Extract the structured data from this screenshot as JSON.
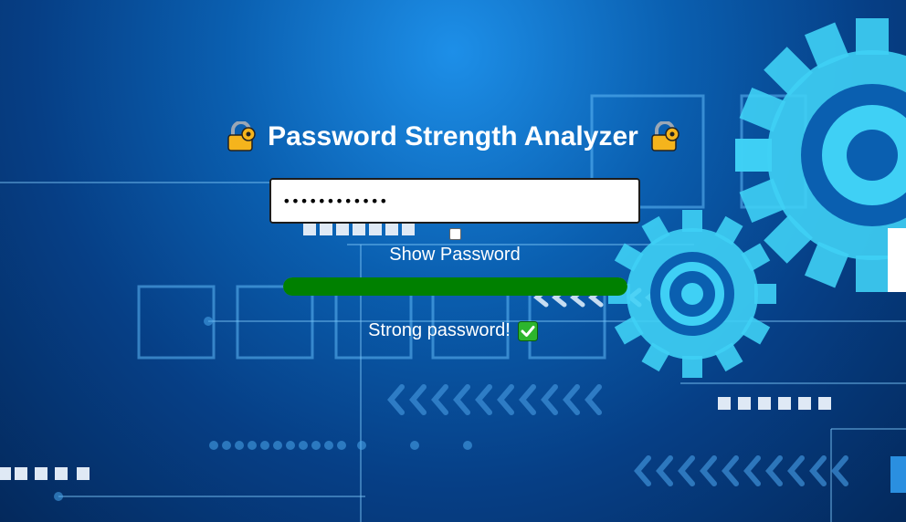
{
  "app": {
    "title": "Password Strength Analyzer"
  },
  "form": {
    "password_value": "••••••••••••",
    "show_password_label": "Show Password",
    "show_password_checked": false
  },
  "strength": {
    "fraction": 1.0,
    "color": "#008000",
    "message": "Strong password!"
  },
  "icons": {
    "title_left": "lock-icon",
    "title_right": "lock-icon",
    "status": "check-icon"
  }
}
